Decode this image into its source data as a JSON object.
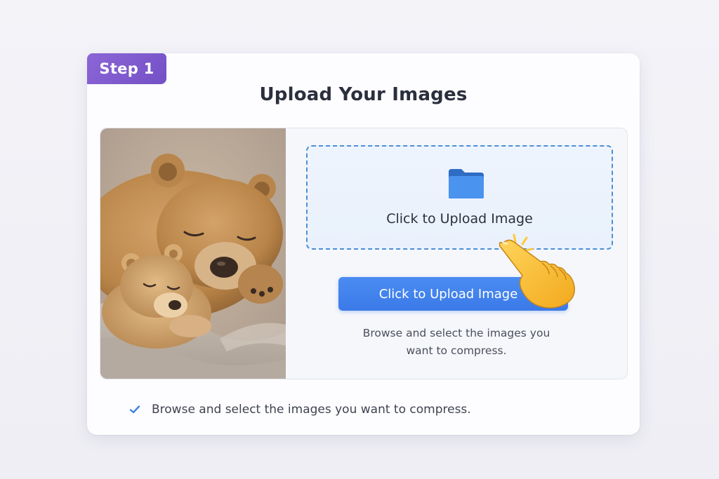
{
  "step_badge": {
    "label": "Step 1",
    "color": "#7e5bd1"
  },
  "header": {
    "title": "Upload Your Images"
  },
  "preview": {
    "icon": "bear-photo"
  },
  "dropzone": {
    "icon": "folder-icon",
    "label": "Click to Upload Image",
    "border_color": "#4b8fd6"
  },
  "upload_button": {
    "label": "Click to Upload Image",
    "color": "#3f80ee"
  },
  "helper_text": {
    "line1": "Browse and select the images you",
    "line2": "want to compress."
  },
  "cursor": {
    "icon": "pointing-hand-icon"
  },
  "footer_bullet": {
    "icon": "checkmark-icon",
    "text": "Browse and select the images you want to compress."
  }
}
